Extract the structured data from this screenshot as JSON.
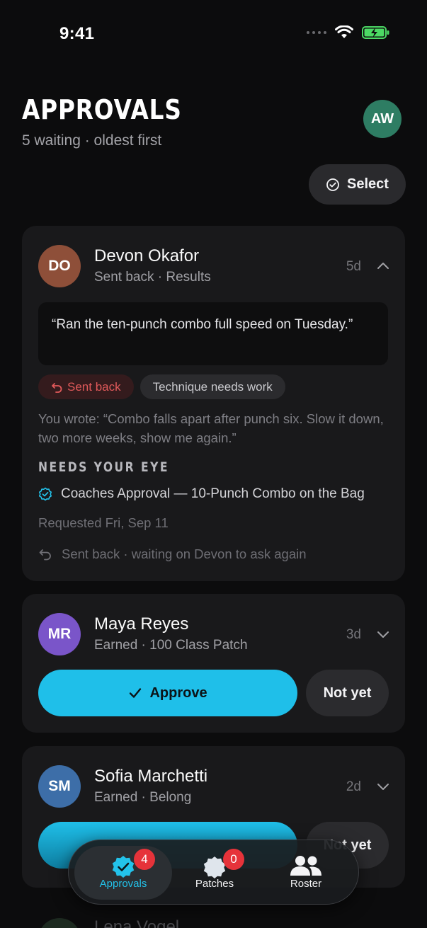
{
  "status": {
    "time": "9:41"
  },
  "header": {
    "title": "APPROVALS",
    "subtitle": "5 waiting · oldest first",
    "avatar_initials": "AW",
    "select_label": "Select"
  },
  "cards": [
    {
      "initials": "DO",
      "name": "Devon Okafor",
      "subtitle": "Sent back · Results",
      "age": "5d",
      "quote": "“Ran the ten-punch combo full speed on Tuesday.”",
      "tags": [
        "Sent back",
        "Technique needs work"
      ],
      "you_wrote": "You wrote: “Combo falls apart after punch six. Slow it down, two more weeks, show me again.”",
      "section_heading": "NEEDS YOUR EYE",
      "request": "Coaches Approval — 10-Punch Combo on the Bag",
      "requested": "Requested Fri, Sep 11",
      "sent_back_note": "Sent back · waiting on Devon to ask again"
    },
    {
      "initials": "MR",
      "name": "Maya Reyes",
      "subtitle": "Earned · 100 Class Patch",
      "age": "3d",
      "approve_label": "Approve",
      "not_yet_label": "Not yet"
    },
    {
      "initials": "SM",
      "name": "Sofia Marchetti",
      "subtitle": "Earned · Belong",
      "age": "2d",
      "not_yet_label": "Not yet"
    }
  ],
  "peek": {
    "name": "Lena Vogel"
  },
  "tabs": [
    {
      "label": "Approvals",
      "badge": "4"
    },
    {
      "label": "Patches",
      "badge": "0"
    },
    {
      "label": "Roster"
    }
  ],
  "colors": {
    "accent": "#1fbfe9",
    "badge": "#e6333a",
    "sent_back": "#e0595a",
    "avatar_aw": "#2e7d63",
    "avatar_do": "#8e4f39",
    "avatar_mr": "#7a55c9",
    "avatar_sm": "#3d6ea8"
  }
}
